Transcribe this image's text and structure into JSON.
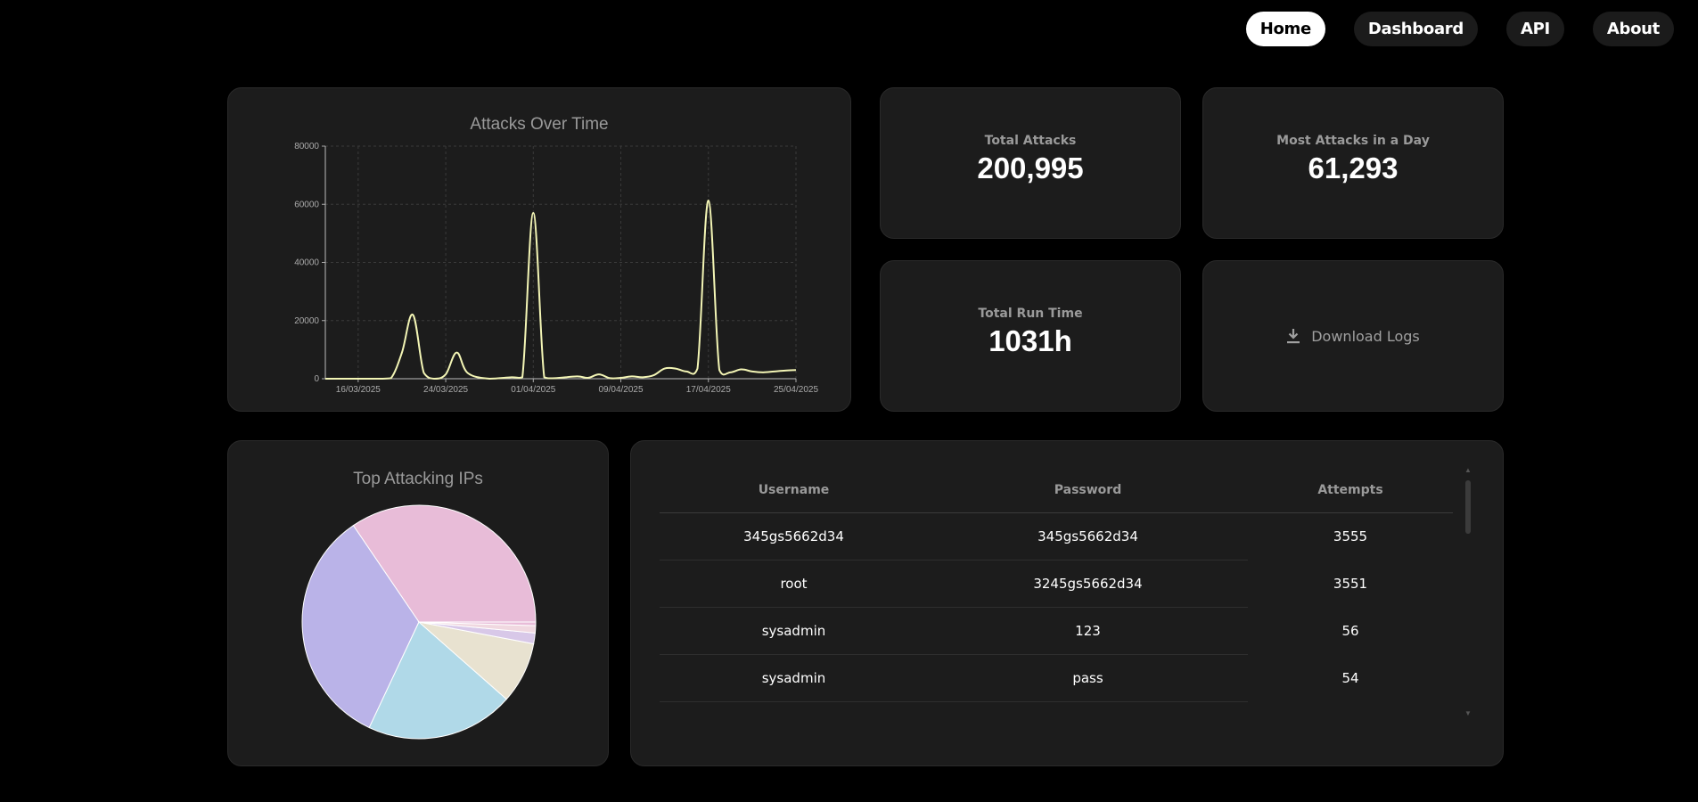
{
  "nav": {
    "items": [
      {
        "label": "Home",
        "active": true
      },
      {
        "label": "Dashboard",
        "active": false
      },
      {
        "label": "API",
        "active": false
      },
      {
        "label": "About",
        "active": false
      }
    ]
  },
  "stats": {
    "total_attacks": {
      "label": "Total Attacks",
      "value": "200,995"
    },
    "most_attacks": {
      "label": "Most Attacks in a Day",
      "value": "61,293"
    },
    "run_time": {
      "label": "Total Run Time",
      "value": "1031h"
    },
    "download": {
      "label": "Download Logs",
      "icon": "download-icon"
    }
  },
  "colors": {
    "line": "#f3f5b5",
    "card_bg": "#1c1c1c",
    "pie": [
      "#e8bcd8",
      "#bab3e8",
      "#b0d9e8",
      "#e8e2d0",
      "#d8c8e8",
      "#f0d8e0"
    ]
  },
  "chart_data": [
    {
      "type": "line",
      "title": "Attacks Over Time",
      "x_ticks": [
        "16/03/2025",
        "24/03/2025",
        "01/04/2025",
        "09/04/2025",
        "17/04/2025",
        "25/04/2025"
      ],
      "y_ticks": [
        "0",
        "20000",
        "40000",
        "60000",
        "80000"
      ],
      "xlim": [
        "13/03/2025",
        "25/04/2025"
      ],
      "ylim": [
        0,
        80000
      ],
      "grid": true,
      "x": [
        "13/03/2025",
        "16/03/2025",
        "18/03/2025",
        "19/03/2025",
        "20/03/2025",
        "21/03/2025",
        "22/03/2025",
        "23/03/2025",
        "24/03/2025",
        "25/03/2025",
        "26/03/2025",
        "28/03/2025",
        "30/03/2025",
        "31/03/2025",
        "01/04/2025",
        "02/04/2025",
        "03/04/2025",
        "05/04/2025",
        "06/04/2025",
        "07/04/2025",
        "08/04/2025",
        "09/04/2025",
        "10/04/2025",
        "11/04/2025",
        "12/04/2025",
        "13/04/2025",
        "14/04/2025",
        "15/04/2025",
        "16/04/2025",
        "17/04/2025",
        "18/04/2025",
        "19/04/2025",
        "20/04/2025",
        "21/04/2025",
        "22/04/2025",
        "23/04/2025",
        "24/04/2025",
        "25/04/2025"
      ],
      "values": [
        0,
        0,
        0,
        200,
        9000,
        22000,
        2000,
        0,
        1500,
        9000,
        2000,
        0,
        500,
        500,
        57000,
        500,
        200,
        800,
        300,
        1500,
        200,
        300,
        800,
        500,
        1200,
        3500,
        3500,
        2500,
        3500,
        61293,
        3000,
        2200,
        3200,
        2500,
        2200,
        2500,
        2800,
        3000
      ]
    },
    {
      "type": "pie",
      "title": "Top Attacking IPs",
      "values": [
        34.5,
        33.5,
        20.5,
        8.5,
        1.5,
        1.0,
        0.5
      ]
    }
  ],
  "table": {
    "columns": [
      "Username",
      "Password",
      "Attempts"
    ],
    "rows": [
      [
        "345gs5662d34",
        "345gs5662d34",
        "3555"
      ],
      [
        "root",
        "3245gs5662d34",
        "3551"
      ],
      [
        "sysadmin",
        "123",
        "56"
      ],
      [
        "sysadmin",
        "pass",
        "54"
      ]
    ]
  }
}
